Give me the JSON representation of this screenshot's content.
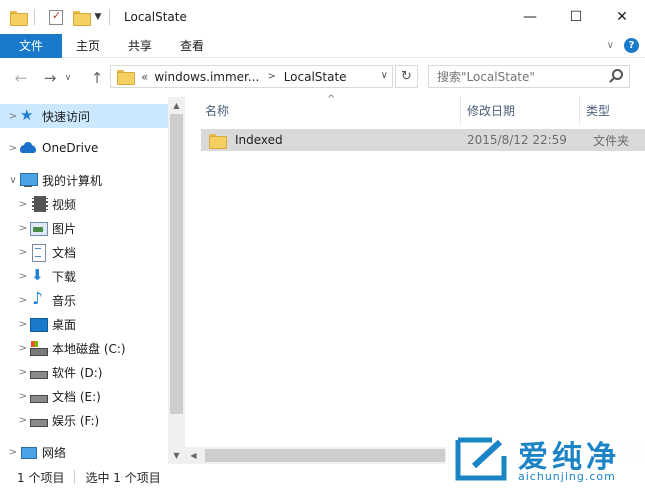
{
  "window": {
    "title": "LocalState",
    "minimize_glyph": "—",
    "maximize_glyph": "☐",
    "close_glyph": "✕"
  },
  "ribbon": {
    "tabs": [
      "文件",
      "主页",
      "共享",
      "查看"
    ],
    "help_glyph": "?",
    "collapse_glyph": "∨"
  },
  "address": {
    "back_glyph": "←",
    "forward_glyph": "→",
    "recent_glyph": "∨",
    "up_glyph": "↑",
    "overflow": "«",
    "crumbs": [
      "windows.immer...",
      "LocalState"
    ],
    "crumb_sep": ">",
    "dropdown_glyph": "∨",
    "refresh_glyph": "↻"
  },
  "search": {
    "placeholder": "搜索\"LocalState\""
  },
  "nav": {
    "items": [
      {
        "label": "快速访问",
        "icon": "star-icon",
        "expander": ">"
      },
      {
        "label": "OneDrive",
        "icon": "cloud-icon",
        "expander": ">"
      },
      {
        "label": "我的计算机",
        "icon": "computer-icon",
        "expander": "∨"
      },
      {
        "label": "视频",
        "icon": "video-icon",
        "expander": ">"
      },
      {
        "label": "图片",
        "icon": "pictures-icon",
        "expander": ">"
      },
      {
        "label": "文档",
        "icon": "documents-icon",
        "expander": ">"
      },
      {
        "label": "下载",
        "icon": "download-icon",
        "expander": ">"
      },
      {
        "label": "音乐",
        "icon": "music-icon",
        "expander": ">"
      },
      {
        "label": "桌面",
        "icon": "desktop-icon",
        "expander": ">"
      },
      {
        "label": "本地磁盘 (C:)",
        "icon": "system-drive-icon",
        "expander": ">"
      },
      {
        "label": "软件 (D:)",
        "icon": "drive-icon",
        "expander": ">"
      },
      {
        "label": "文档 (E:)",
        "icon": "drive-icon",
        "expander": ">"
      },
      {
        "label": "娱乐 (F:)",
        "icon": "drive-icon",
        "expander": ">"
      },
      {
        "label": "网络",
        "icon": "network-icon",
        "expander": ">"
      }
    ],
    "selected_index": 0
  },
  "columns": {
    "name": "名称",
    "date": "修改日期",
    "type": "类型",
    "sort_glyph": "^"
  },
  "files": [
    {
      "name": "Indexed",
      "date": "2015/8/12 22:59",
      "type": "文件夹"
    }
  ],
  "status": {
    "count": "1 个项目",
    "selected": "选中 1 个项目"
  },
  "scroll": {
    "up": "▲",
    "down": "▼",
    "left": "◀",
    "right": "▶"
  },
  "watermark": {
    "cn": "爱纯净",
    "en": "aichunjing.com"
  },
  "colors": {
    "accent": "#1979ca",
    "selection": "#cce8ff",
    "row_highlight": "#d9d9d9",
    "watermark": "#1a84c6"
  }
}
